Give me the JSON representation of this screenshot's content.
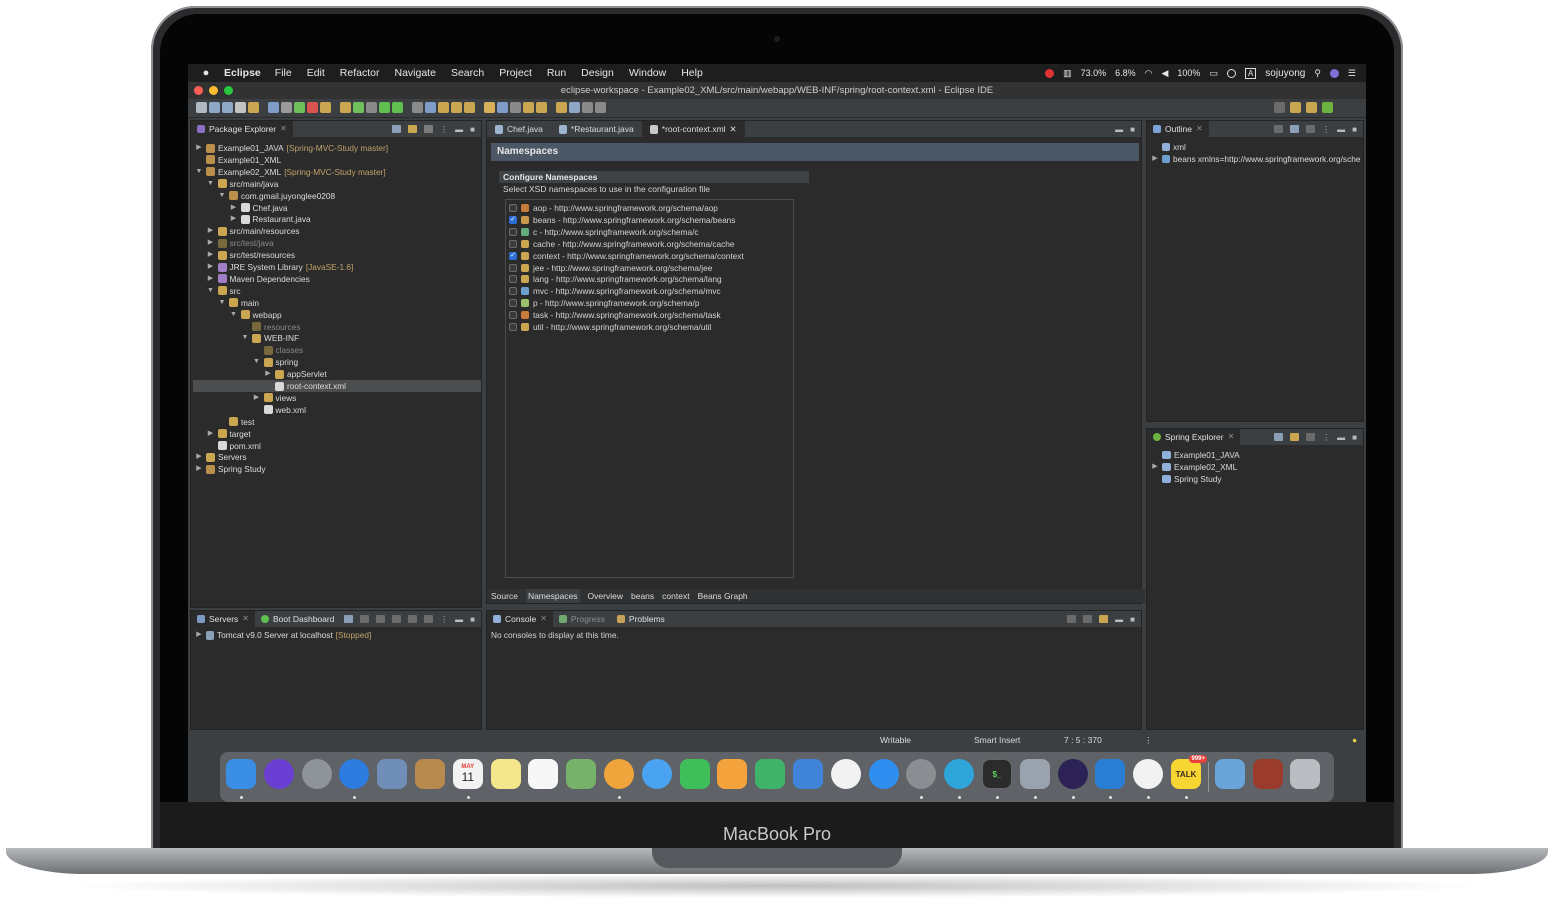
{
  "device": {
    "brand": "MacBook Pro"
  },
  "menubar": {
    "app": "Eclipse",
    "items": [
      "File",
      "Edit",
      "Refactor",
      "Navigate",
      "Search",
      "Project",
      "Run",
      "Design",
      "Window",
      "Help"
    ],
    "tray": {
      "cpu": "73.0%",
      "mem": "6.8%",
      "battery": "100%",
      "user": "sojuyong",
      "input": "A"
    }
  },
  "window": {
    "title": "eclipse-workspace - Example02_XML/src/main/webapp/WEB-INF/spring/root-context.xml - Eclipse IDE"
  },
  "package_explorer": {
    "title": "Package Explorer",
    "rows": [
      {
        "indent": 0,
        "arrow": "▶",
        "text": "Example01_JAVA",
        "deco": "[Spring-MVC-Study master]",
        "icon": "project-icon",
        "dim": false
      },
      {
        "indent": 0,
        "arrow": "",
        "text": "Example01_XML",
        "deco": "",
        "icon": "project-icon",
        "dim": false
      },
      {
        "indent": 0,
        "arrow": "▼",
        "text": "Example02_XML",
        "deco": "[Spring-MVC-Study master]",
        "icon": "project-icon",
        "dim": false
      },
      {
        "indent": 1,
        "arrow": "▼",
        "text": "src/main/java",
        "deco": "",
        "icon": "folder-icon",
        "dim": false
      },
      {
        "indent": 2,
        "arrow": "▼",
        "text": "com.gmail.juyonglee0208",
        "deco": "",
        "icon": "package-icon",
        "dim": false
      },
      {
        "indent": 3,
        "arrow": "▶",
        "text": "Chef.java",
        "deco": "",
        "icon": "java-file-icon",
        "dim": false
      },
      {
        "indent": 3,
        "arrow": "▶",
        "text": "Restaurant.java",
        "deco": "",
        "icon": "java-file-icon",
        "dim": false
      },
      {
        "indent": 1,
        "arrow": "▶",
        "text": "src/main/resources",
        "deco": "",
        "icon": "folder-icon",
        "dim": false
      },
      {
        "indent": 1,
        "arrow": "▶",
        "text": "src/test/java",
        "deco": "",
        "icon": "folder-icon",
        "dim": true
      },
      {
        "indent": 1,
        "arrow": "▶",
        "text": "src/test/resources",
        "deco": "",
        "icon": "folder-icon",
        "dim": false
      },
      {
        "indent": 1,
        "arrow": "▶",
        "text": "JRE System Library",
        "deco": "[JavaSE-1.6]",
        "icon": "library-icon",
        "dim": false
      },
      {
        "indent": 1,
        "arrow": "▶",
        "text": "Maven Dependencies",
        "deco": "",
        "icon": "library-icon",
        "dim": false
      },
      {
        "indent": 1,
        "arrow": "▼",
        "text": "src",
        "deco": "",
        "icon": "folder-icon",
        "dim": false
      },
      {
        "indent": 2,
        "arrow": "▼",
        "text": "main",
        "deco": "",
        "icon": "folder-icon",
        "dim": false
      },
      {
        "indent": 3,
        "arrow": "▼",
        "text": "webapp",
        "deco": "",
        "icon": "folder-icon",
        "dim": false
      },
      {
        "indent": 4,
        "arrow": "",
        "text": "resources",
        "deco": "",
        "icon": "folder-icon",
        "dim": true
      },
      {
        "indent": 4,
        "arrow": "▼",
        "text": "WEB-INF",
        "deco": "",
        "icon": "folder-icon",
        "dim": false
      },
      {
        "indent": 5,
        "arrow": "",
        "text": "classes",
        "deco": "",
        "icon": "folder-icon",
        "dim": true
      },
      {
        "indent": 5,
        "arrow": "▼",
        "text": "spring",
        "deco": "",
        "icon": "folder-icon",
        "dim": false
      },
      {
        "indent": 6,
        "arrow": "▶",
        "text": "appServlet",
        "deco": "",
        "icon": "folder-icon",
        "dim": false
      },
      {
        "indent": 6,
        "arrow": "",
        "text": "root-context.xml",
        "deco": "",
        "icon": "xml-file-icon",
        "dim": false
      },
      {
        "indent": 5,
        "arrow": "▶",
        "text": "views",
        "deco": "",
        "icon": "folder-icon",
        "dim": false
      },
      {
        "indent": 5,
        "arrow": "",
        "text": "web.xml",
        "deco": "",
        "icon": "xml-file-icon",
        "dim": false
      },
      {
        "indent": 2,
        "arrow": "",
        "text": "test",
        "deco": "",
        "icon": "folder-icon",
        "dim": false
      },
      {
        "indent": 1,
        "arrow": "▶",
        "text": "target",
        "deco": "",
        "icon": "folder-icon",
        "dim": false
      },
      {
        "indent": 1,
        "arrow": "",
        "text": "pom.xml",
        "deco": "",
        "icon": "xml-file-icon",
        "dim": false
      },
      {
        "indent": 0,
        "arrow": "▶",
        "text": "Servers",
        "deco": "",
        "icon": "folder-icon",
        "dim": false
      },
      {
        "indent": 0,
        "arrow": "▶",
        "text": "Spring Study",
        "deco": "",
        "icon": "project-icon",
        "dim": false
      }
    ],
    "selected_index": 20
  },
  "servers_panel": {
    "tabs": [
      "Servers",
      "Boot Dashboard"
    ],
    "server": {
      "name": "Tomcat v9.0 Server at localhost",
      "status": "[Stopped]"
    }
  },
  "editor": {
    "tabs": [
      "Chef.java",
      "*Restaurant.java",
      "*root-context.xml"
    ],
    "active_tab": 2,
    "header": "Namespaces",
    "section_title": "Configure Namespaces",
    "section_desc": "Select XSD namespaces to use in the configuration file",
    "namespaces": [
      {
        "label": "aop - http://www.springframework.org/schema/aop",
        "checked": false
      },
      {
        "label": "beans - http://www.springframework.org/schema/beans",
        "checked": true
      },
      {
        "label": "c - http://www.springframework.org/schema/c",
        "checked": false
      },
      {
        "label": "cache - http://www.springframework.org/schema/cache",
        "checked": false
      },
      {
        "label": "context - http://www.springframework.org/schema/context",
        "checked": true
      },
      {
        "label": "jee - http://www.springframework.org/schema/jee",
        "checked": false
      },
      {
        "label": "lang - http://www.springframework.org/schema/lang",
        "checked": false
      },
      {
        "label": "mvc - http://www.springframework.org/schema/mvc",
        "checked": false
      },
      {
        "label": "p - http://www.springframework.org/schema/p",
        "checked": false
      },
      {
        "label": "task - http://www.springframework.org/schema/task",
        "checked": false
      },
      {
        "label": "util - http://www.springframework.org/schema/util",
        "checked": false
      }
    ],
    "bottom_tabs": [
      "Source",
      "Namespaces",
      "Overview",
      "beans",
      "context",
      "Beans Graph"
    ]
  },
  "console": {
    "tabs": [
      "Console",
      "Progress",
      "Problems"
    ],
    "message": "No consoles to display at this time."
  },
  "outline": {
    "title": "Outline",
    "rows": [
      {
        "arrow": "",
        "text": "xml"
      },
      {
        "arrow": "▶",
        "text": "beans xmlns=http://www.springframework.org/sche"
      }
    ]
  },
  "spring_explorer": {
    "title": "Spring Explorer",
    "rows": [
      {
        "arrow": "",
        "text": "Example01_JAVA"
      },
      {
        "arrow": "▶",
        "text": "Example02_XML"
      },
      {
        "arrow": "",
        "text": "Spring Study"
      }
    ]
  },
  "statusbar": {
    "writable": "Writable",
    "insert_mode": "Smart Insert",
    "position": "7 : 5 : 370"
  },
  "dock": {
    "calendar_month": "MAY",
    "calendar_day": "11",
    "talk_badge": "999+",
    "talk_label": "TALK",
    "apps": [
      {
        "name": "finder-icon",
        "color": "#3a8ee6"
      },
      {
        "name": "siri-icon",
        "color": "#6b3fd4"
      },
      {
        "name": "launchpad-icon",
        "color": "#8f939a"
      },
      {
        "name": "safari-icon",
        "color": "#2d7de0"
      },
      {
        "name": "mail-preview-icon",
        "color": "#6f8fb8"
      },
      {
        "name": "contacts-icon",
        "color": "#b88a4e"
      },
      {
        "name": "calendar-icon",
        "color": "#f2f2f2"
      },
      {
        "name": "notes-icon",
        "color": "#f4e68c"
      },
      {
        "name": "reminders-icon",
        "color": "#f7f7f7"
      },
      {
        "name": "maps-icon",
        "color": "#77b26b"
      },
      {
        "name": "photos-icon",
        "color": "#f0a43c"
      },
      {
        "name": "messages-icon",
        "color": "#4aa3f0"
      },
      {
        "name": "facetime-icon",
        "color": "#3fbf5a"
      },
      {
        "name": "pages-icon",
        "color": "#f3a23c"
      },
      {
        "name": "numbers-icon",
        "color": "#3fb36a"
      },
      {
        "name": "keynote-icon",
        "color": "#3f84d8"
      },
      {
        "name": "music-icon",
        "color": "#f2f2f2"
      },
      {
        "name": "app-store-icon",
        "color": "#2f8ef0"
      },
      {
        "name": "system-preferences-icon",
        "color": "#8a8d92"
      },
      {
        "name": "telegram-icon",
        "color": "#2ea6da"
      },
      {
        "name": "terminal-icon",
        "color": "#2b2b2b"
      },
      {
        "name": "preview-icon",
        "color": "#9aa3ad"
      },
      {
        "name": "eclipse-icon",
        "color": "#2c2255"
      },
      {
        "name": "vscode-icon",
        "color": "#2a7fd4"
      },
      {
        "name": "line-icon",
        "color": "#f2f2f2"
      },
      {
        "name": "kakaotalk-icon",
        "color": "#f7d533"
      },
      {
        "name": "downloads-folder-icon",
        "color": "#6aa4d8"
      },
      {
        "name": "screenshot-icon",
        "color": "#9b3b2b"
      },
      {
        "name": "trash-icon",
        "color": "#b9bcc0"
      }
    ],
    "running": [
      0,
      3,
      6,
      10,
      18,
      19,
      20,
      21,
      22,
      23,
      24,
      25
    ]
  }
}
